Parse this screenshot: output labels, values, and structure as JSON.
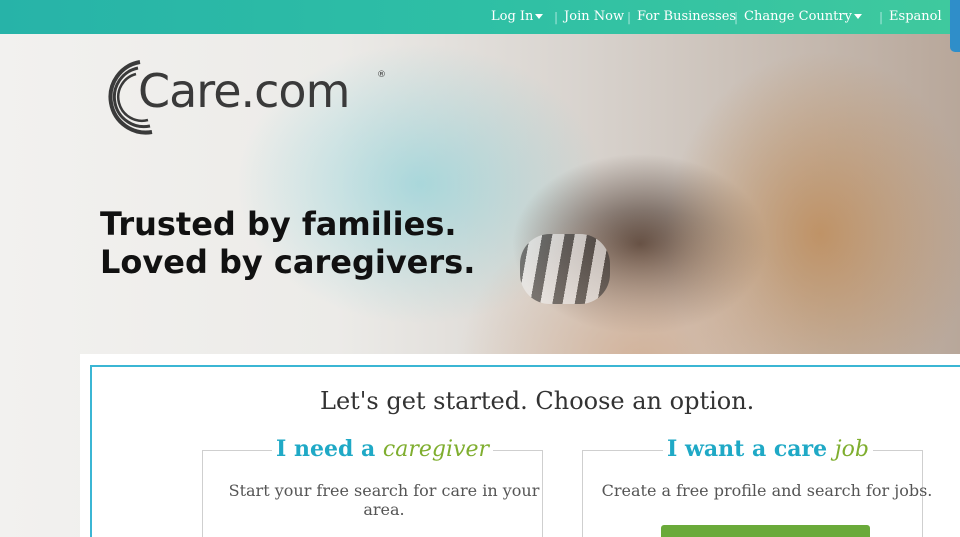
{
  "nav": {
    "login": "Log In",
    "join": "Join Now",
    "business": "For Businesses",
    "country": "Change Country",
    "language": "Espanol"
  },
  "logo": {
    "text": "Care.com",
    "registered": "®"
  },
  "hero": {
    "line1": "Trusted by families.",
    "line2": "Loved by caregivers."
  },
  "card": {
    "title": "Let's get started. Choose an option.",
    "option_need": {
      "heading": "I need a",
      "script": "caregiver",
      "description": "Start your free search for care in your area."
    },
    "option_want": {
      "heading": "I want a care",
      "script": "job",
      "description": "Create a free profile and search for jobs."
    }
  },
  "colors": {
    "topbar": "#2ebfa5",
    "accent_blue": "#1fa9c6",
    "accent_green": "#7fae2f",
    "button_green": "#6aaa3a"
  }
}
